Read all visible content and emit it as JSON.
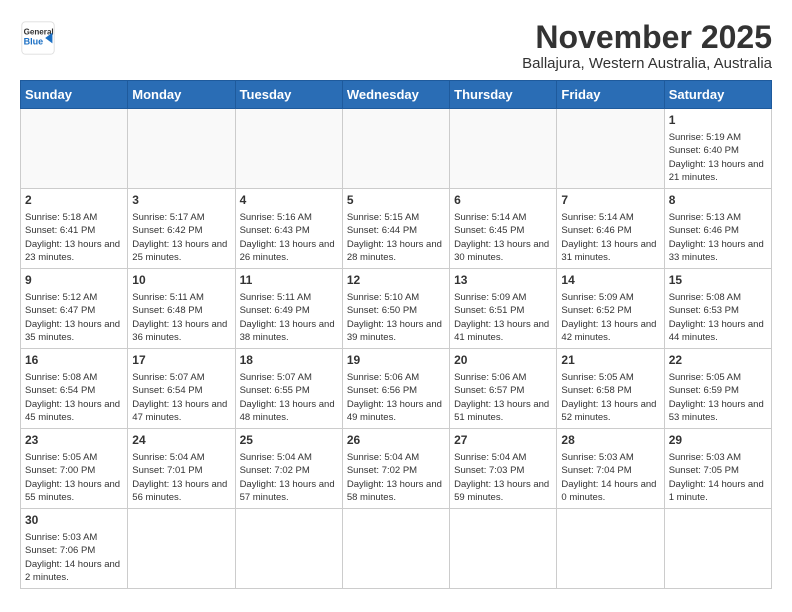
{
  "header": {
    "logo_general": "General",
    "logo_blue": "Blue",
    "month_title": "November 2025",
    "location": "Ballajura, Western Australia, Australia"
  },
  "weekdays": [
    "Sunday",
    "Monday",
    "Tuesday",
    "Wednesday",
    "Thursday",
    "Friday",
    "Saturday"
  ],
  "weeks": [
    [
      null,
      null,
      null,
      null,
      null,
      null,
      {
        "day": "1",
        "sunrise": "5:19 AM",
        "sunset": "6:40 PM",
        "daylight": "13 hours and 21 minutes."
      }
    ],
    [
      {
        "day": "2",
        "sunrise": "5:18 AM",
        "sunset": "6:41 PM",
        "daylight": "13 hours and 23 minutes."
      },
      {
        "day": "3",
        "sunrise": "5:17 AM",
        "sunset": "6:42 PM",
        "daylight": "13 hours and 25 minutes."
      },
      {
        "day": "4",
        "sunrise": "5:16 AM",
        "sunset": "6:43 PM",
        "daylight": "13 hours and 26 minutes."
      },
      {
        "day": "5",
        "sunrise": "5:15 AM",
        "sunset": "6:44 PM",
        "daylight": "13 hours and 28 minutes."
      },
      {
        "day": "6",
        "sunrise": "5:14 AM",
        "sunset": "6:45 PM",
        "daylight": "13 hours and 30 minutes."
      },
      {
        "day": "7",
        "sunrise": "5:14 AM",
        "sunset": "6:46 PM",
        "daylight": "13 hours and 31 minutes."
      },
      {
        "day": "8",
        "sunrise": "5:13 AM",
        "sunset": "6:46 PM",
        "daylight": "13 hours and 33 minutes."
      }
    ],
    [
      {
        "day": "9",
        "sunrise": "5:12 AM",
        "sunset": "6:47 PM",
        "daylight": "13 hours and 35 minutes."
      },
      {
        "day": "10",
        "sunrise": "5:11 AM",
        "sunset": "6:48 PM",
        "daylight": "13 hours and 36 minutes."
      },
      {
        "day": "11",
        "sunrise": "5:11 AM",
        "sunset": "6:49 PM",
        "daylight": "13 hours and 38 minutes."
      },
      {
        "day": "12",
        "sunrise": "5:10 AM",
        "sunset": "6:50 PM",
        "daylight": "13 hours and 39 minutes."
      },
      {
        "day": "13",
        "sunrise": "5:09 AM",
        "sunset": "6:51 PM",
        "daylight": "13 hours and 41 minutes."
      },
      {
        "day": "14",
        "sunrise": "5:09 AM",
        "sunset": "6:52 PM",
        "daylight": "13 hours and 42 minutes."
      },
      {
        "day": "15",
        "sunrise": "5:08 AM",
        "sunset": "6:53 PM",
        "daylight": "13 hours and 44 minutes."
      }
    ],
    [
      {
        "day": "16",
        "sunrise": "5:08 AM",
        "sunset": "6:54 PM",
        "daylight": "13 hours and 45 minutes."
      },
      {
        "day": "17",
        "sunrise": "5:07 AM",
        "sunset": "6:54 PM",
        "daylight": "13 hours and 47 minutes."
      },
      {
        "day": "18",
        "sunrise": "5:07 AM",
        "sunset": "6:55 PM",
        "daylight": "13 hours and 48 minutes."
      },
      {
        "day": "19",
        "sunrise": "5:06 AM",
        "sunset": "6:56 PM",
        "daylight": "13 hours and 49 minutes."
      },
      {
        "day": "20",
        "sunrise": "5:06 AM",
        "sunset": "6:57 PM",
        "daylight": "13 hours and 51 minutes."
      },
      {
        "day": "21",
        "sunrise": "5:05 AM",
        "sunset": "6:58 PM",
        "daylight": "13 hours and 52 minutes."
      },
      {
        "day": "22",
        "sunrise": "5:05 AM",
        "sunset": "6:59 PM",
        "daylight": "13 hours and 53 minutes."
      }
    ],
    [
      {
        "day": "23",
        "sunrise": "5:05 AM",
        "sunset": "7:00 PM",
        "daylight": "13 hours and 55 minutes."
      },
      {
        "day": "24",
        "sunrise": "5:04 AM",
        "sunset": "7:01 PM",
        "daylight": "13 hours and 56 minutes."
      },
      {
        "day": "25",
        "sunrise": "5:04 AM",
        "sunset": "7:02 PM",
        "daylight": "13 hours and 57 minutes."
      },
      {
        "day": "26",
        "sunrise": "5:04 AM",
        "sunset": "7:02 PM",
        "daylight": "13 hours and 58 minutes."
      },
      {
        "day": "27",
        "sunrise": "5:04 AM",
        "sunset": "7:03 PM",
        "daylight": "13 hours and 59 minutes."
      },
      {
        "day": "28",
        "sunrise": "5:03 AM",
        "sunset": "7:04 PM",
        "daylight": "14 hours and 0 minutes."
      },
      {
        "day": "29",
        "sunrise": "5:03 AM",
        "sunset": "7:05 PM",
        "daylight": "14 hours and 1 minute."
      }
    ],
    [
      {
        "day": "30",
        "sunrise": "5:03 AM",
        "sunset": "7:06 PM",
        "daylight": "14 hours and 2 minutes."
      },
      null,
      null,
      null,
      null,
      null,
      null
    ]
  ]
}
